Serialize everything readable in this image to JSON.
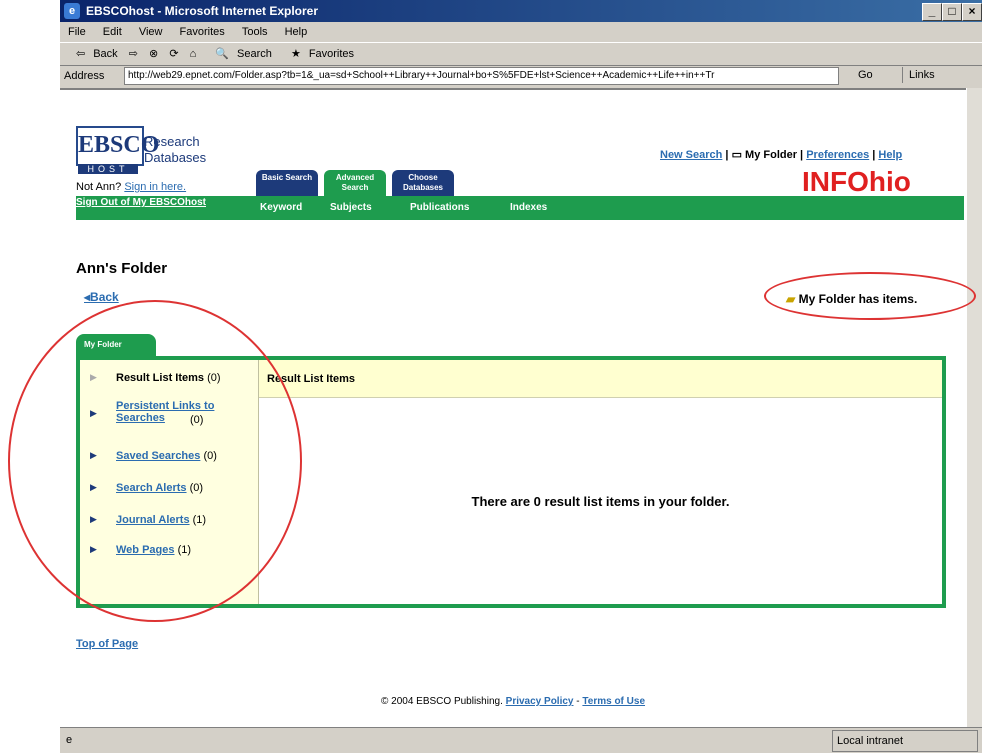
{
  "window": {
    "title": "EBSCOhost - Microsoft Internet Explorer",
    "menu": [
      "File",
      "Edit",
      "View",
      "Favorites",
      "Tools",
      "Help"
    ],
    "toolbar": [
      "Back",
      "Search",
      "Favorites"
    ],
    "address_label": "Address",
    "address": "http://web29.epnet.com/Folder.asp?tb=1&_ua=sd+School++Library++Journal+bo+S%5FDE+lst+Science++Academic++Life++in++Tr",
    "go": "Go",
    "links": "Links",
    "status": "Local intranet"
  },
  "header": {
    "logo_main": "EBSCO",
    "logo_host": "HOST",
    "logo_sub": "Research Databases",
    "not_user": "Not Ann?",
    "sign_in": "Sign in here.",
    "sign_out": "Sign Out of My EBSCOhost",
    "tabs": [
      "Basic Search",
      "Advanced Search",
      "Choose Databases"
    ],
    "subtabs": [
      "Keyword",
      "Subjects",
      "Publications",
      "Indexes"
    ],
    "links": [
      "New Search",
      "My Folder",
      "Preferences",
      "Help"
    ],
    "brand": "INFOhio"
  },
  "folder": {
    "title": "Ann's Folder",
    "back": "Back",
    "has_items": "My Folder has items.",
    "tab": "My Folder",
    "nav": [
      {
        "label": "Result List Items",
        "count": "(0)"
      },
      {
        "label": "Persistent Links to Searches",
        "count": "(0)"
      },
      {
        "label": "Saved Searches",
        "count": "(0)"
      },
      {
        "label": "Search Alerts",
        "count": "(0)"
      },
      {
        "label": "Journal Alerts",
        "count": "(1)"
      },
      {
        "label": "Web Pages",
        "count": "(1)"
      }
    ],
    "section_title": "Result List Items",
    "empty_message": "There are 0 result list items in your folder."
  },
  "footer": {
    "top_of_page": "Top of Page",
    "copyright": "© 2004 EBSCO Publishing.",
    "privacy": "Privacy Policy",
    "sep": "-",
    "terms": "Terms of Use"
  },
  "colors": {
    "green": "#1e9c4e",
    "navy": "#1d3a7a",
    "link": "#2b6cb0",
    "highlight_red": "#dd3333"
  }
}
